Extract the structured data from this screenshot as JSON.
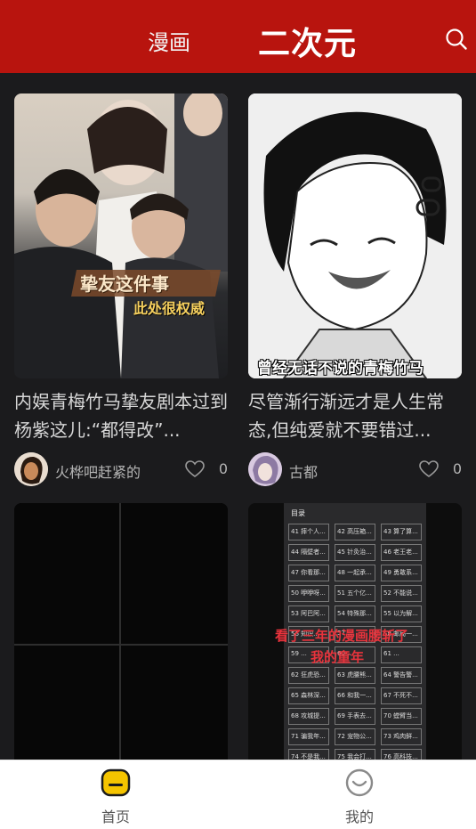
{
  "header": {
    "tab_manhua": "漫画",
    "tab_erciyuan": "二次元",
    "search_icon": "search-icon",
    "bg_color": "#b8140e"
  },
  "feed": {
    "cards": [
      {
        "title": "内娱青梅竹马挚友剧本过到杨紫这儿:“都得改”...",
        "cover_caption_1": "挚友这件事",
        "cover_caption_2": "此处很权威",
        "author": "火桦吧赶紧的",
        "likes": "0"
      },
      {
        "title": "尽管渐行渐远才是人生常态,但纯爱就不要错过...",
        "cover_caption_1": "曾经无话不说的青梅竹马",
        "author": "古都",
        "likes": "0"
      },
      {
        "title": "",
        "author": "",
        "likes": ""
      },
      {
        "title": "",
        "cover_caption_1": "看了三年的漫画腰斩了",
        "cover_caption_2": "我的童年",
        "toc_header": "目录",
        "toc_items": [
          "41 摔个人...",
          "42 高压箱...",
          "43 算了算...",
          "44 隔壁者...",
          "45 针灸治...",
          "46 老王老...",
          "47 你看那...",
          "48 一起承...",
          "49 勇敢系...",
          "50 咿咿呀...",
          "51 五个亿...",
          "52 不能说...",
          "53 阿巴阿...",
          "54 特殊那...",
          "55 以为解...",
          "56 知识...",
          "57 ...",
          "58 邮局一...",
          "59 ...",
          "60 ...",
          "61 ...",
          "62 狂虎恐...",
          "63 虎腰熊...",
          "64 警告警...",
          "65 森林深...",
          "66 和我一...",
          "67 不死不...",
          "68 攻城提...",
          "69 手表去...",
          "70 螳臂当...",
          "71 骗我年...",
          "72 宠物公...",
          "73 鸡肉鲜...",
          "74 不是我...",
          "75 我会打...",
          "76 高科技..."
        ]
      }
    ]
  },
  "tabbar": {
    "home_label": "首页",
    "mine_label": "我的",
    "active_color": "#f5c400"
  }
}
